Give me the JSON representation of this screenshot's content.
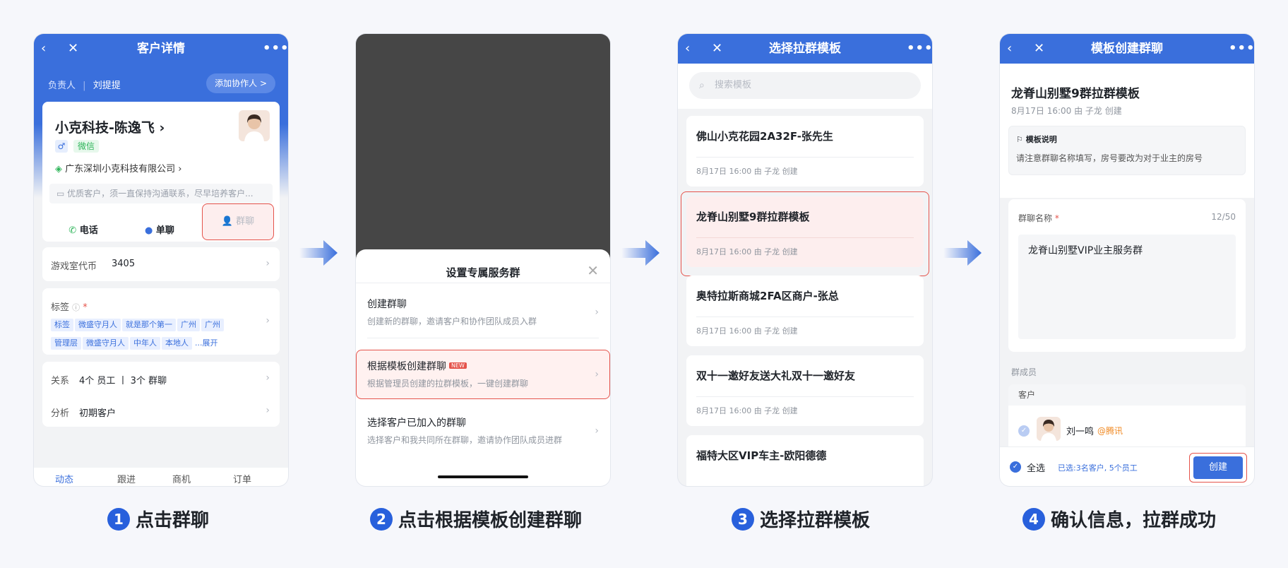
{
  "phone1": {
    "nav_title": "客户详情",
    "owner_label": "负责人",
    "owner_name": "刘提提",
    "add_collab": "添加协作人 >",
    "customer_name": "小克科技-陈逸飞 ›",
    "gender": "♂",
    "source_tag": "微信",
    "company": "广东深圳小克科技有限公司 ›",
    "note": "优质客户，须一直保持沟通联系，尽早培养客户...",
    "actions": {
      "phone": "电话",
      "chat": "单聊",
      "group": "群聊"
    },
    "coin_label": "游戏室代币",
    "coin_value": "3405",
    "tags_label": "标签",
    "tags_row1": [
      "标签",
      "微盛守月人",
      "就是那个第一",
      "广州",
      "广州"
    ],
    "tags_row2": [
      "管理层",
      "微盛守月人",
      "中年人",
      "本地人"
    ],
    "tags_more": "...展开",
    "relation_label": "关系",
    "relation_value": "4个 员工 丨 3个 群聊",
    "analysis_label": "分析",
    "analysis_value": "初期客户",
    "tabs": [
      "动态",
      "跟进",
      "商机",
      "订单"
    ]
  },
  "phone2": {
    "sheet_title": "设置专属服务群",
    "options": [
      {
        "title": "创建群聊",
        "desc": "创建新的群聊，邀请客户和协作团队成员入群"
      },
      {
        "title": "根据模板创建群聊",
        "desc": "根据管理员创建的拉群模板，一键创建群聊",
        "badge": "NEW"
      },
      {
        "title": "选择客户已加入的群聊",
        "desc": "选择客户和我共同所在群聊，邀请协作团队成员进群"
      }
    ]
  },
  "phone3": {
    "nav_title": "选择拉群模板",
    "search_placeholder": "搜索模板",
    "templates": [
      {
        "name": "佛山小克花园2A32F-张先生",
        "meta": "8月17日 16:00  由 子龙 创建"
      },
      {
        "name": "龙脊山别墅9群拉群模板",
        "meta": "8月17日 16:00  由 子龙 创建"
      },
      {
        "name": "奥特拉斯商城2FA区商户-张总",
        "meta": "8月17日 16:00  由 子龙 创建"
      },
      {
        "name": "双十一邀好友送大礼双十一邀好友",
        "meta": "8月17日 16:00  由 子龙 创建"
      },
      {
        "name": "福特大区VIP车主-欧阳德德",
        "meta": ""
      }
    ]
  },
  "phone4": {
    "nav_title": "模板创建群聊",
    "template_name": "龙脊山别墅9群拉群模板",
    "template_meta": "8月17日 16:00  由 子龙 创建",
    "desc_title": "模板说明",
    "desc_body": "请注意群聊名称填写，房号要改为对于业主的房号",
    "name_label": "群聊名称",
    "name_count": "12/50",
    "name_value": "龙脊山别墅VIP业主服务群",
    "members_label": "群成员",
    "customer_label": "客户",
    "member_name": "刘一鸣",
    "member_org": "@腾讯",
    "select_all": "全选",
    "selected_text": "已选:3名客户, 5个员工",
    "create_button": "创建"
  },
  "captions": [
    {
      "num": "1",
      "text": "点击群聊"
    },
    {
      "num": "2",
      "text": "点击根据模板创建群聊"
    },
    {
      "num": "3",
      "text": "选择拉群模板"
    },
    {
      "num": "4",
      "text": "确认信息，拉群成功"
    }
  ],
  "colors": {
    "brand": "#3a6fdc",
    "highlight": "#e5534b",
    "caption_num": "#2860dc"
  }
}
